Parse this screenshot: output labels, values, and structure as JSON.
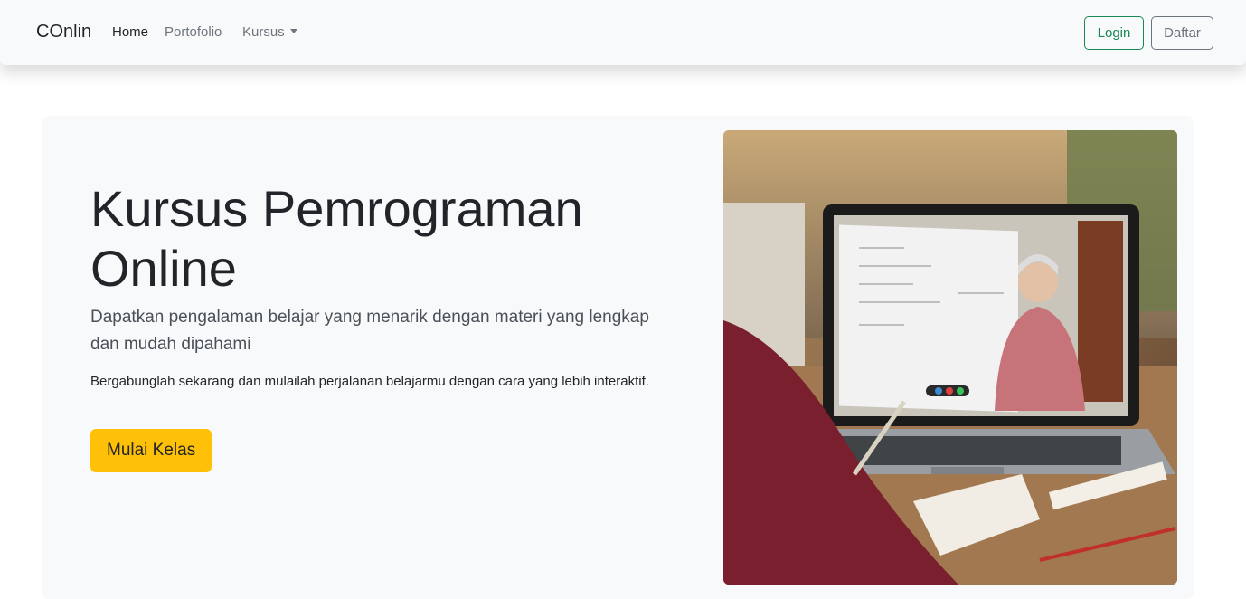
{
  "navbar": {
    "brand": "COnlin",
    "links": [
      {
        "label": "Home"
      },
      {
        "label": "Portofolio"
      },
      {
        "label": "Kursus"
      }
    ],
    "login_label": "Login",
    "register_label": "Daftar"
  },
  "hero": {
    "title_line1": "Kursus Pemrograman",
    "title_line2": "Online",
    "lead": "Dapatkan pengalaman belajar yang menarik dengan materi yang lengkap dan mudah dipahami",
    "text": "Bergabunglah sekarang dan mulailah perjalanan belajarmu dengan cara yang lebih interaktif.",
    "cta_label": "Mulai Kelas",
    "image_icon": "online-class-photo"
  },
  "colors": {
    "navbar_bg": "#f8f9fa",
    "success": "#198754",
    "secondary": "#6c757d",
    "warning": "#ffc107"
  }
}
